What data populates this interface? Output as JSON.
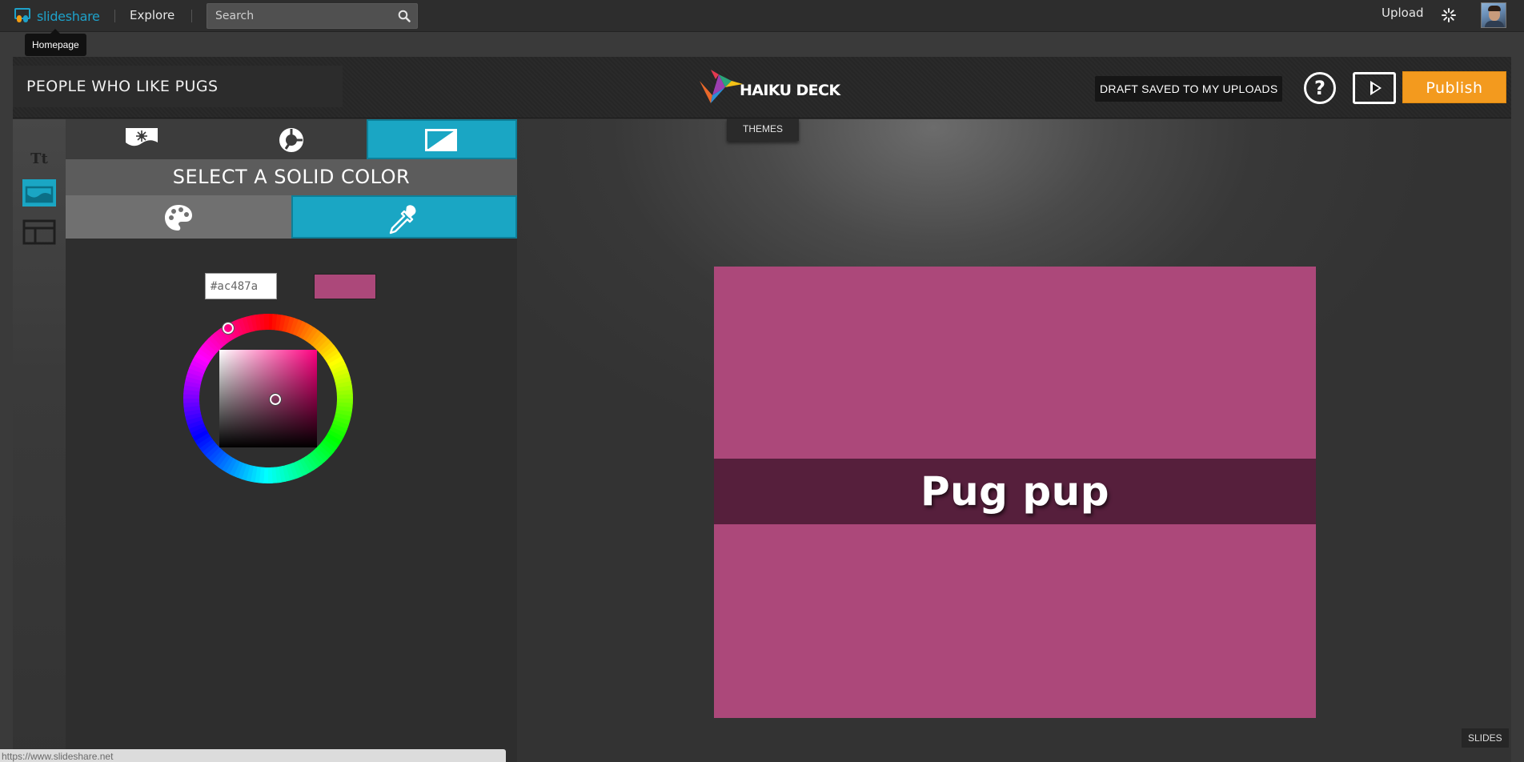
{
  "slideshare": {
    "logo_text": "slideshare",
    "explore_label": "Explore",
    "search_placeholder": "Search",
    "upload_label": "Upload",
    "homepage_tooltip": "Homepage",
    "icons": [
      "slideshare-logo-icon",
      "search-icon",
      "activity-icon",
      "avatar"
    ]
  },
  "editor": {
    "deck_title": "PEOPLE WHO LIKE PUGS",
    "logo_text": "HAIKU DECK",
    "draft_status": "DRAFT SAVED TO MY UPLOADS",
    "help_label": "?",
    "publish_label": "Publish",
    "themes_label": "THEMES",
    "slides_label": "SLIDES"
  },
  "side_tools": [
    {
      "name": "text-tool",
      "label": "Tt",
      "active": false
    },
    {
      "name": "background-tool",
      "active": true
    },
    {
      "name": "layout-tool",
      "active": false
    }
  ],
  "background_panel": {
    "tabs": [
      "image",
      "chart",
      "solid-color"
    ],
    "active_tab": "solid-color",
    "heading": "SELECT A SOLID COLOR",
    "sub_tabs": [
      "palette",
      "eyedropper"
    ],
    "active_sub_tab": "eyedropper",
    "hex_value": "#ac487a",
    "selected_color": "#ac487a"
  },
  "slide": {
    "title": "Pug pup",
    "background_color": "#ac487a",
    "band_color": "#561f3c"
  },
  "status_bar": {
    "url": "https://www.slideshare.net"
  },
  "colors": {
    "accent_cyan": "#1aa6c4",
    "publish_orange": "#f39a1e",
    "slideshare_blue": "#1ea1c9"
  }
}
